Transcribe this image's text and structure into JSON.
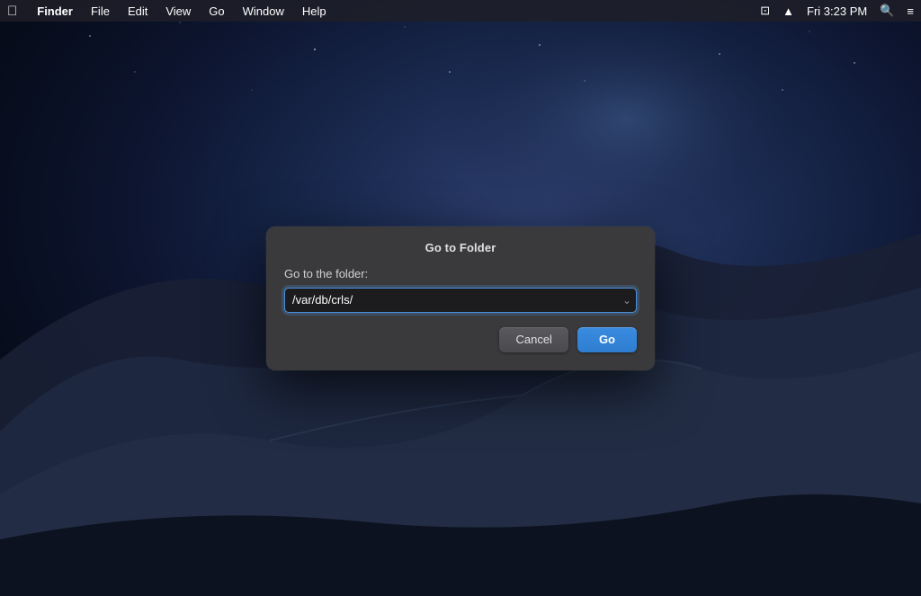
{
  "menubar": {
    "apple_label": "",
    "app_name": "Finder",
    "menus": [
      "File",
      "Edit",
      "View",
      "Go",
      "Window",
      "Help"
    ],
    "time": "Fri 3:23 PM",
    "icons": {
      "screen_share": "⊡",
      "eject": "⏏",
      "search": "⌕",
      "control_center": "≡"
    }
  },
  "dialog": {
    "title": "Go to Folder",
    "label": "Go to the folder:",
    "input_value": "/var/db/crls/",
    "input_placeholder": "/var/db/crls/",
    "chevron": "⌄",
    "cancel_label": "Cancel",
    "go_label": "Go"
  }
}
